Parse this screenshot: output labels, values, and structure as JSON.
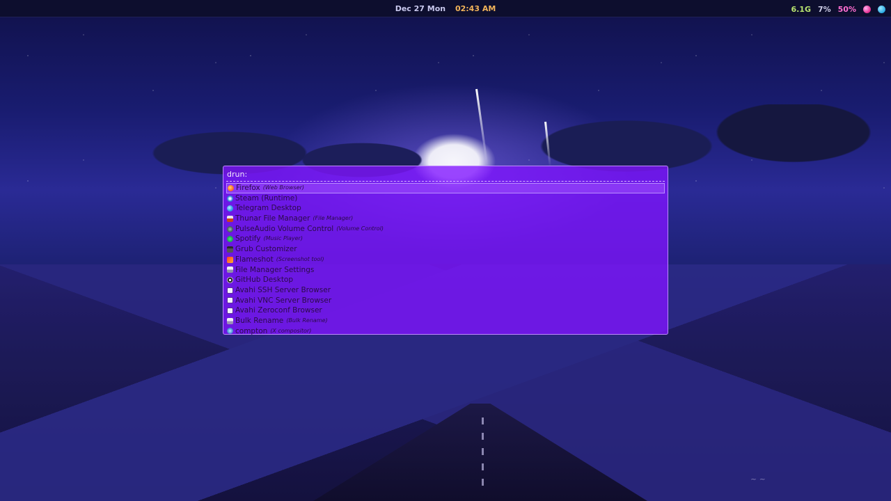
{
  "topbar": {
    "date": "Dec 27 Mon",
    "time": "02:43 AM",
    "memory": "6.1G",
    "cpu": "7%",
    "volume": "50%",
    "tray_icons": [
      "pink-tray-icon",
      "telegram-tray-icon"
    ],
    "colors": {
      "time": "#f0b35a",
      "memory": "#b7e36f",
      "volume": "#ff6ed1"
    }
  },
  "launcher": {
    "mode_prompt": "drun:",
    "query": "",
    "accent_color": "#8014ff",
    "items": [
      {
        "name": "Firefox",
        "generic": "(Web Browser)",
        "icon": "firefox-icon",
        "selected": true
      },
      {
        "name": "Steam (Runtime)",
        "generic": "",
        "icon": "steam-icon"
      },
      {
        "name": "Telegram Desktop",
        "generic": "",
        "icon": "telegram-icon"
      },
      {
        "name": "Thunar File Manager",
        "generic": "(File Manager)",
        "icon": "thunar-icon"
      },
      {
        "name": "PulseAudio Volume Control",
        "generic": "(Volume Control)",
        "icon": "pulseaudio-icon"
      },
      {
        "name": "Spotify",
        "generic": "(Music Player)",
        "icon": "spotify-icon"
      },
      {
        "name": "Grub Customizer",
        "generic": "",
        "icon": "grub-icon"
      },
      {
        "name": "Flameshot",
        "generic": "(Screenshot tool)",
        "icon": "flameshot-icon"
      },
      {
        "name": "File Manager Settings",
        "generic": "",
        "icon": "file-manager-settings-icon"
      },
      {
        "name": "GitHub Desktop",
        "generic": "",
        "icon": "github-icon"
      },
      {
        "name": "Avahi SSH Server Browser",
        "generic": "",
        "icon": "avahi-icon"
      },
      {
        "name": "Avahi VNC Server Browser",
        "generic": "",
        "icon": "avahi-icon"
      },
      {
        "name": "Avahi Zeroconf Browser",
        "generic": "",
        "icon": "avahi-icon"
      },
      {
        "name": "Bulk Rename",
        "generic": "(Bulk Rename)",
        "icon": "bulk-rename-icon"
      },
      {
        "name": "compton",
        "generic": "(X compositor)",
        "icon": "compton-icon"
      }
    ]
  }
}
